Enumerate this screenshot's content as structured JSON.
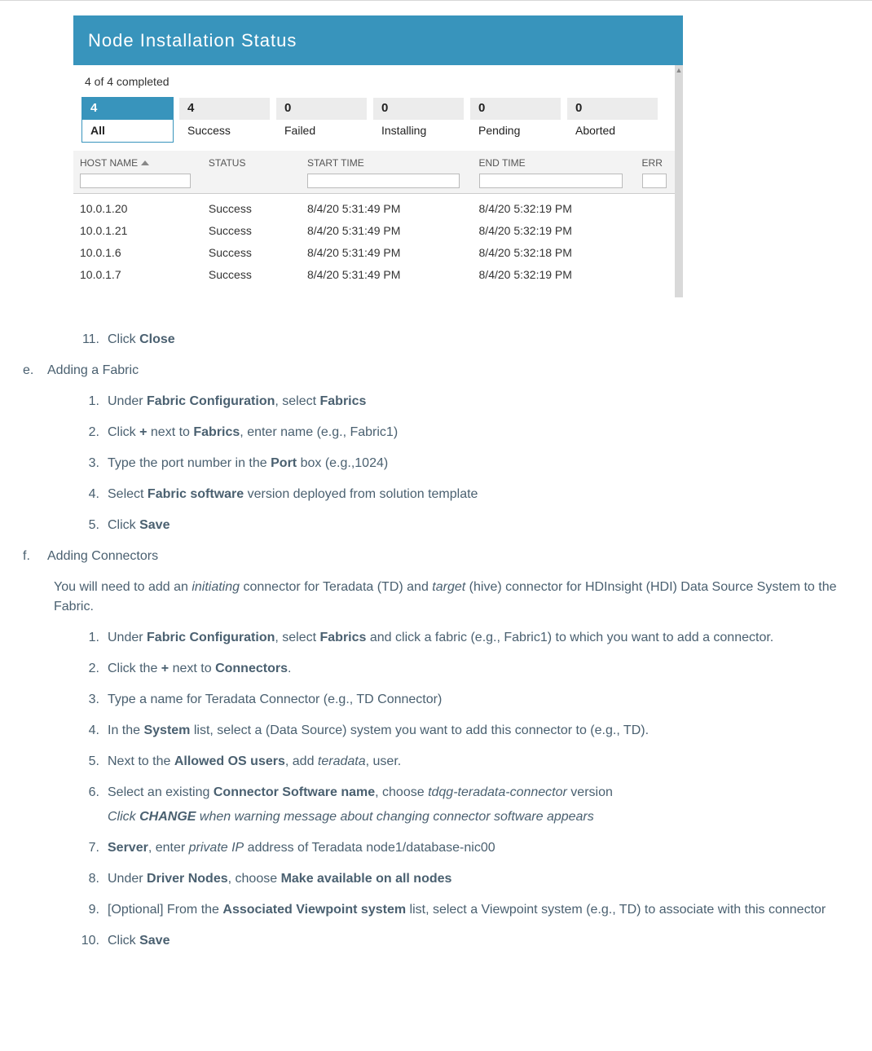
{
  "screenshot": {
    "title": "Node Installation Status",
    "completed_text": "4 of 4 completed",
    "filters": [
      {
        "count": "4",
        "label": "All",
        "active": true
      },
      {
        "count": "4",
        "label": "Success",
        "active": false
      },
      {
        "count": "0",
        "label": "Failed",
        "active": false
      },
      {
        "count": "0",
        "label": "Installing",
        "active": false
      },
      {
        "count": "0",
        "label": "Pending",
        "active": false
      },
      {
        "count": "0",
        "label": "Aborted",
        "active": false
      }
    ],
    "columns": {
      "host": "HOST NAME",
      "status": "STATUS",
      "start": "START TIME",
      "end": "END TIME",
      "err": "ERR"
    },
    "rows": [
      {
        "host": "10.0.1.20",
        "status": "Success",
        "start": "8/4/20 5:31:49 PM",
        "end": "8/4/20 5:32:19 PM"
      },
      {
        "host": "10.0.1.21",
        "status": "Success",
        "start": "8/4/20 5:31:49 PM",
        "end": "8/4/20 5:32:19 PM"
      },
      {
        "host": "10.0.1.6",
        "status": "Success",
        "start": "8/4/20 5:31:49 PM",
        "end": "8/4/20 5:32:18 PM"
      },
      {
        "host": "10.0.1.7",
        "status": "Success",
        "start": "8/4/20 5:31:49 PM",
        "end": "8/4/20 5:32:19 PM"
      }
    ]
  },
  "doc": {
    "step11": {
      "num": "11.",
      "pre": "Click ",
      "b": "Close"
    },
    "e": {
      "marker": "e.",
      "title": "Adding a Fabric"
    },
    "e_steps": [
      {
        "num": "1.",
        "parts": [
          "Under ",
          "<b>Fabric Configuration</b>",
          ", select ",
          "<b>Fabrics</b>"
        ]
      },
      {
        "num": "2.",
        "parts": [
          "Click ",
          "<b>+</b>",
          " next to ",
          "<b>Fabrics</b>",
          ", enter name (e.g., Fabric1)"
        ]
      },
      {
        "num": "3.",
        "parts": [
          "Type the port number in the ",
          "<b>Port</b>",
          " box (e.g.,1024)"
        ]
      },
      {
        "num": "4.",
        "parts": [
          "Select ",
          "<b>Fabric software</b>",
          " version deployed from solution template"
        ]
      },
      {
        "num": "5.",
        "parts": [
          "Click ",
          "<b>Save</b>"
        ]
      }
    ],
    "f": {
      "marker": "f.",
      "title": "Adding Connectors"
    },
    "f_intro": [
      "You will need to add an ",
      "<i>initiating</i>",
      " connector for Teradata (TD) and ",
      "<i>target</i>",
      " (hive) connector for HDInsight (HDI) Data Source System to the Fabric."
    ],
    "f_steps": [
      {
        "num": "1.",
        "parts": [
          "Under ",
          "<b>Fabric Configuration</b>",
          ", select ",
          "<b>Fabrics</b>",
          " and click a fabric (e.g., Fabric1) to which you want to add a connector."
        ]
      },
      {
        "num": "2.",
        "parts": [
          "Click the ",
          "<b>+</b>",
          " next to ",
          "<b>Connectors</b>",
          "."
        ]
      },
      {
        "num": "3.",
        "parts": [
          "Type a name for Teradata Connector (e.g., TD Connector)"
        ]
      },
      {
        "num": "4.",
        "parts": [
          "In the ",
          "<b>System</b>",
          " list, select a (Data Source) system you want to add this connector to (e.g., TD)."
        ]
      },
      {
        "num": "5.",
        "parts": [
          "Next to the ",
          "<b>Allowed OS users</b>",
          ", add ",
          "<i>teradata</i>",
          ", user."
        ]
      },
      {
        "num": "6.",
        "parts": [
          "Select an existing ",
          "<b>Connector Software name</b>",
          ", choose ",
          "<i>tdqg-teradata-connector</i>",
          " version"
        ],
        "sub": [
          "<i>Click </i>",
          "<i><b>CHANGE</b></i>",
          "<i> when warning message about changing connector software appears</i>"
        ]
      },
      {
        "num": "7.",
        "parts": [
          "<b>Server</b>",
          ", enter ",
          "<i>private IP</i>",
          " address of Teradata node1/database-nic00"
        ]
      },
      {
        "num": "8.",
        "parts": [
          "Under ",
          "<b>Driver Nodes</b>",
          ", choose ",
          "<b>Make available on all nodes</b>"
        ]
      },
      {
        "num": "9.",
        "parts": [
          "[Optional] From the ",
          "<b>Associated Viewpoint system</b>",
          " list, select a Viewpoint system (e.g., TD) to associate with this connector"
        ]
      },
      {
        "num": "10.",
        "parts": [
          "Click ",
          "<b>Save</b>"
        ]
      }
    ]
  }
}
